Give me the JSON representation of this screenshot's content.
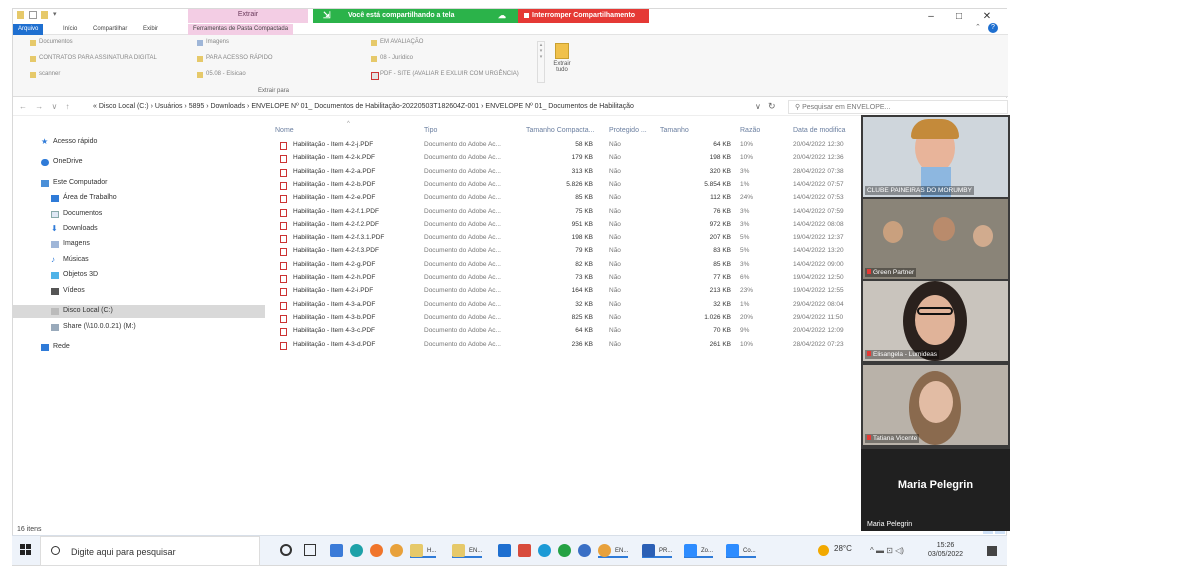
{
  "ribbon": {
    "extrair_top": "Extrair",
    "tabs": [
      "Arquivo",
      "Início",
      "Compartilhar",
      "Exibir",
      "Ferramentas de Pasta Compactada"
    ],
    "col1": [
      "Documentos",
      "CONTRATOS PARA ASSINATURA DIGITAL",
      "scanner"
    ],
    "col2": [
      "Imagens",
      "PARA ACESSO RÁPIDO",
      "05.08 - Elsicao"
    ],
    "col3": [
      "EM AVALIAÇÃO",
      "08 - Jurídico",
      "PDF - SITE (AVALIAR E EXLUIR COM URGÊNCIA)"
    ],
    "extract_all": "Extrair tudo",
    "group_label": "Extrair para"
  },
  "share": {
    "message": "Você está compartilhando a tela",
    "stop": "Interromper Compartilhamento"
  },
  "address": {
    "arrows": "← → ∨ ↑",
    "path": "« Disco Local (C:) › Usuários › 5895 › Downloads › ENVELOPE Nº 01_ Documentos de Habilitação-20220503T182604Z-001 › ENVELOPE Nº 01_ Documentos de Habilitação",
    "search": "Pesquisar em ENVELOPE..."
  },
  "sidebar": {
    "items": [
      "Acesso rápido",
      "OneDrive",
      "Este Computador",
      "Área de Trabalho",
      "Documentos",
      "Downloads",
      "Imagens",
      "Músicas",
      "Objetos 3D",
      "Vídeos",
      "Disco Local (C:)",
      "Share (\\\\10.0.0.21) (M:)",
      "Rede"
    ],
    "count": "16 itens"
  },
  "files": {
    "headers": [
      "Nome",
      "Tipo",
      "Tamanho Compacta...",
      "Protegido ...",
      "Tamanho",
      "Razão",
      "Data de modifica"
    ],
    "rows": [
      [
        "Habilitação - Item 4-2-j.PDF",
        "Documento do Adobe Ac...",
        "58 KB",
        "Não",
        "64 KB",
        "10%",
        "20/04/2022 12:30"
      ],
      [
        "Habilitação - Item 4-2-k.PDF",
        "Documento do Adobe Ac...",
        "179 KB",
        "Não",
        "198 KB",
        "10%",
        "20/04/2022 12:36"
      ],
      [
        "Habilitação - Item 4-2-a.PDF",
        "Documento do Adobe Ac...",
        "313 KB",
        "Não",
        "320 KB",
        "3%",
        "28/04/2022 07:38"
      ],
      [
        "Habilitação - Item 4-2-b.PDF",
        "Documento do Adobe Ac...",
        "5.826 KB",
        "Não",
        "5.854 KB",
        "1%",
        "14/04/2022 07:57"
      ],
      [
        "Habilitação - Item 4-2-e.PDF",
        "Documento do Adobe Ac...",
        "85 KB",
        "Não",
        "112 KB",
        "24%",
        "14/04/2022 07:53"
      ],
      [
        "Habilitação - Item 4-2-f.1.PDF",
        "Documento do Adobe Ac...",
        "75 KB",
        "Não",
        "76 KB",
        "3%",
        "14/04/2022 07:59"
      ],
      [
        "Habilitação - Item 4-2-f.2.PDF",
        "Documento do Adobe Ac...",
        "951 KB",
        "Não",
        "972 KB",
        "3%",
        "14/04/2022 08:08"
      ],
      [
        "Habilitação - Item 4-2-f.3.1.PDF",
        "Documento do Adobe Ac...",
        "198 KB",
        "Não",
        "207 KB",
        "5%",
        "19/04/2022 12:37"
      ],
      [
        "Habilitação - Item 4-2-f.3.PDF",
        "Documento do Adobe Ac...",
        "79 KB",
        "Não",
        "83 KB",
        "5%",
        "14/04/2022 13:20"
      ],
      [
        "Habilitação - Item 4-2-g.PDF",
        "Documento do Adobe Ac...",
        "82 KB",
        "Não",
        "85 KB",
        "3%",
        "14/04/2022 09:00"
      ],
      [
        "Habilitação - Item 4-2-h.PDF",
        "Documento do Adobe Ac...",
        "73 KB",
        "Não",
        "77 KB",
        "6%",
        "19/04/2022 12:50"
      ],
      [
        "Habilitação - Item 4-2-i.PDF",
        "Documento do Adobe Ac...",
        "164 KB",
        "Não",
        "213 KB",
        "23%",
        "19/04/2022 12:55"
      ],
      [
        "Habilitação - Item 4-3-a.PDF",
        "Documento do Adobe Ac...",
        "32 KB",
        "Não",
        "32 KB",
        "1%",
        "29/04/2022 08:04"
      ],
      [
        "Habilitação - Item 4-3-b.PDF",
        "Documento do Adobe Ac...",
        "825 KB",
        "Não",
        "1.026 KB",
        "20%",
        "29/04/2022 11:50"
      ],
      [
        "Habilitação - Item 4-3-c.PDF",
        "Documento do Adobe Ac...",
        "64 KB",
        "Não",
        "70 KB",
        "9%",
        "20/04/2022 12:09"
      ],
      [
        "Habilitação - Item 4-3-d.PDF",
        "Documento do Adobe Ac...",
        "236 KB",
        "Não",
        "261 KB",
        "10%",
        "28/04/2022 07:23"
      ]
    ]
  },
  "video": {
    "tiles": [
      "CLUBE PAINEIRAS DO MORUMBY",
      "Green Partner",
      "Elisangela - Lumideas",
      "Tatiana Vicente"
    ],
    "speaker_big": "Maria Pelegrin",
    "speaker_small": "Maria Pelegrin"
  },
  "taskbar": {
    "search": "Digite aqui para pesquisar",
    "apps": [
      "H...",
      "EN...",
      "EN...",
      "PR...",
      "Zo...",
      "Co..."
    ],
    "weather": "28°C",
    "time": "15:26",
    "date": "03/05/2022"
  },
  "colors": {
    "share_green": "#2bb34a",
    "stop_red": "#e53935",
    "arquivo_blue": "#1e6fd0",
    "context_pink": "#f3cde4"
  }
}
